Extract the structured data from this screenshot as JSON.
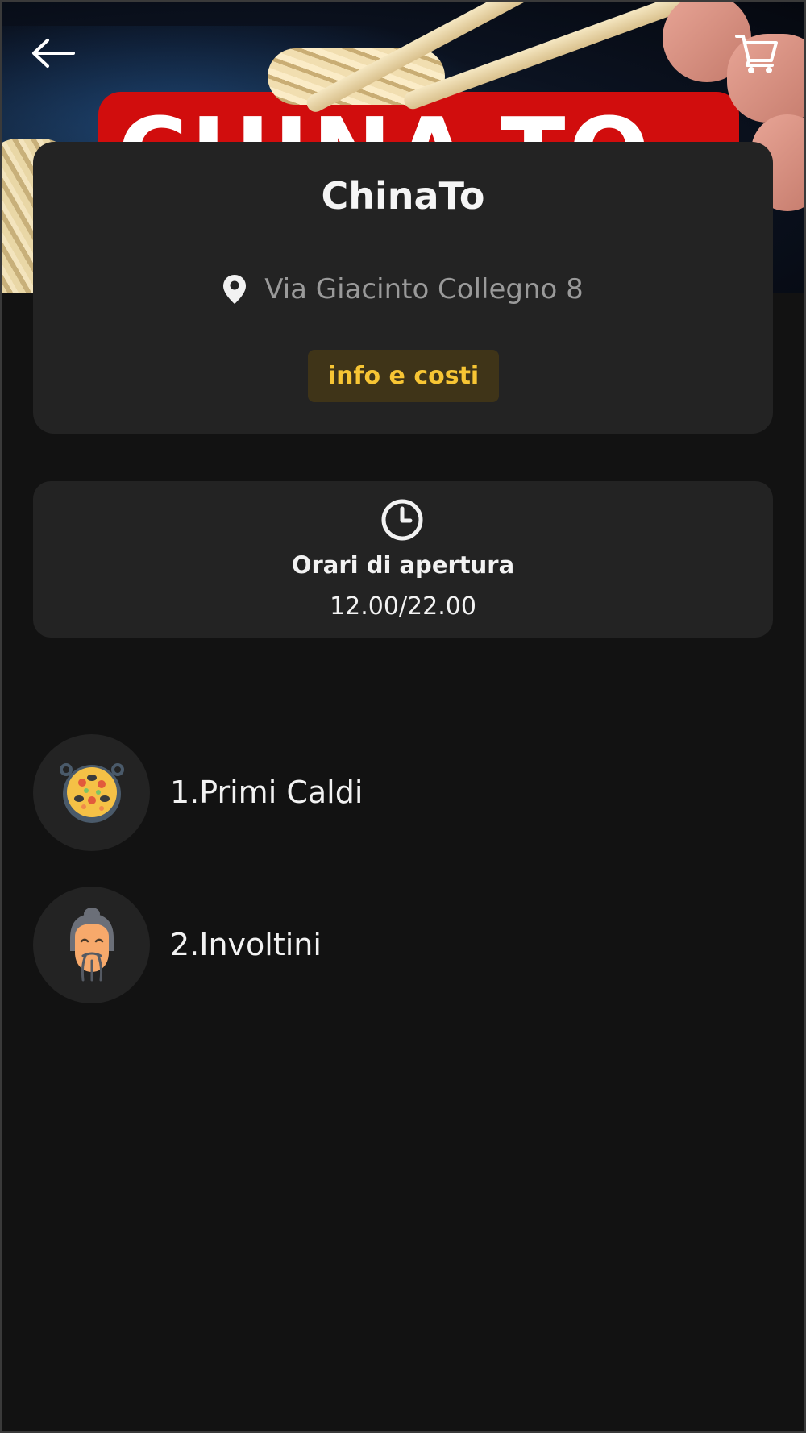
{
  "header": {
    "banner_text": "CHINA-TO",
    "back_icon": "arrow-left-icon",
    "cart_icon": "cart-icon"
  },
  "restaurant": {
    "name": "ChinaTo",
    "address_icon": "location-pin-icon",
    "address": "Via Giacinto Collegno 8",
    "info_button_label": "info e costi"
  },
  "hours": {
    "icon": "clock-icon",
    "title": "Orari di apertura",
    "value": "12.00/22.00"
  },
  "categories": [
    {
      "label": "1.Primi Caldi",
      "icon": "paella-pan-icon"
    },
    {
      "label": "2.Involtini",
      "icon": "chinese-man-icon"
    }
  ],
  "colors": {
    "background": "#121212",
    "card": "#232323",
    "accent": "#f7c534",
    "accent_bg": "#3f3418",
    "muted_text": "#9a9a9a",
    "banner_red": "#d10d0d"
  }
}
